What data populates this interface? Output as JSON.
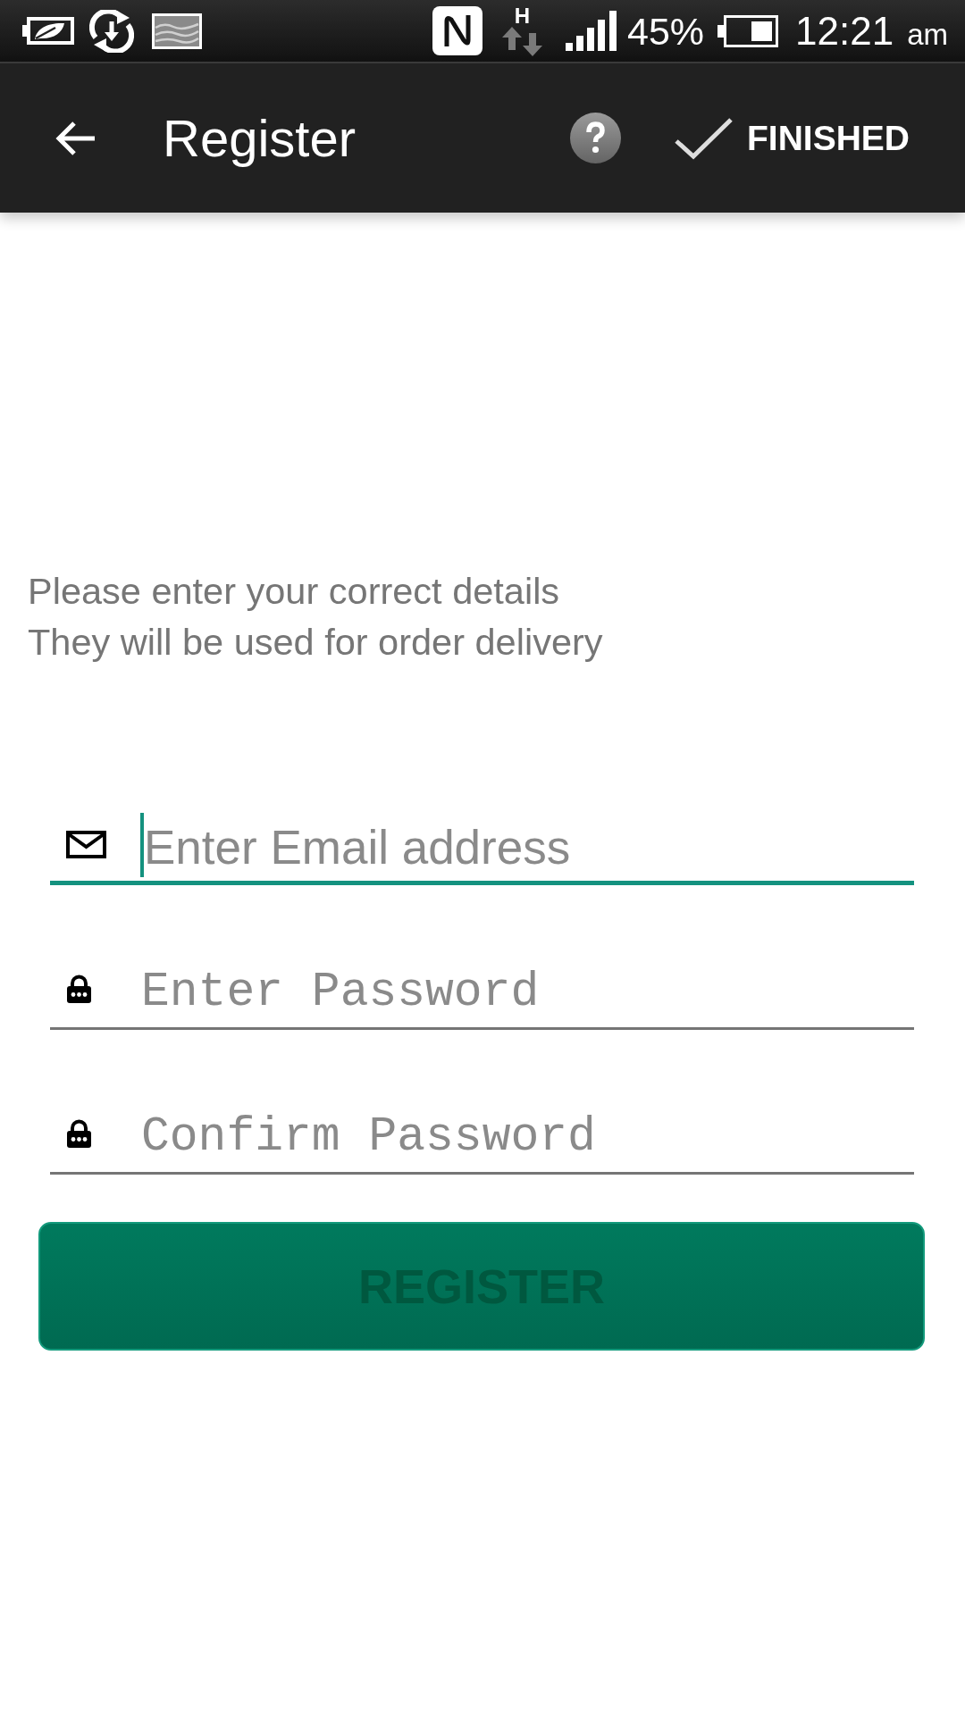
{
  "status_bar": {
    "network_type": "H",
    "battery_percent": "45%",
    "time": "12:21",
    "meridiem": "am"
  },
  "app_bar": {
    "title": "Register",
    "action": "FINISHED"
  },
  "intro": [
    "Please enter your correct details",
    "They will be used for order delivery"
  ],
  "fields": [
    {
      "kind": "email",
      "placeholder": "Enter Email address",
      "focused": true
    },
    {
      "kind": "password",
      "placeholder": "Enter Password",
      "focused": false
    },
    {
      "kind": "password",
      "placeholder": "Confirm Password",
      "focused": false
    }
  ],
  "button": {
    "label": "REGISTER",
    "disabled": true
  }
}
